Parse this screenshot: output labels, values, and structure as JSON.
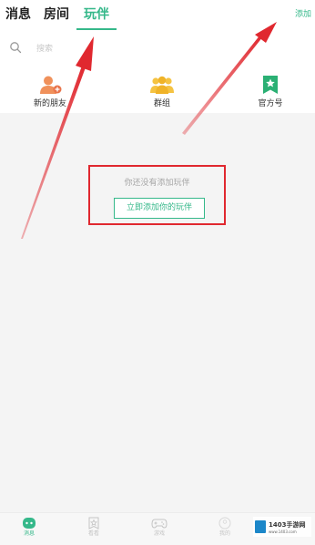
{
  "header": {
    "tabs": [
      {
        "label": "消息"
      },
      {
        "label": "房间"
      },
      {
        "label": "玩伴"
      }
    ],
    "active_tab": 2,
    "add_label": "添加"
  },
  "search": {
    "placeholder": "搜索"
  },
  "quick_entries": [
    {
      "label": "新的朋友",
      "icon": "new-friend-icon"
    },
    {
      "label": "群组",
      "icon": "group-icon"
    },
    {
      "label": "官方号",
      "icon": "official-account-icon"
    }
  ],
  "empty_state": {
    "text": "你还没有添加玩伴",
    "button_label": "立即添加你的玩伴"
  },
  "bottom_nav": [
    {
      "label": "消息",
      "icon": "message-icon",
      "active": true
    },
    {
      "label": "看看",
      "icon": "star-icon",
      "active": false
    },
    {
      "label": "游戏",
      "icon": "gamepad-icon",
      "active": false
    },
    {
      "label": "我的",
      "icon": "profile-icon",
      "active": false
    }
  ],
  "watermark": {
    "text": "1403手游网",
    "sub": "www.1403.com"
  },
  "colors": {
    "accent": "#35b88a",
    "annotation": "#e0282f"
  }
}
